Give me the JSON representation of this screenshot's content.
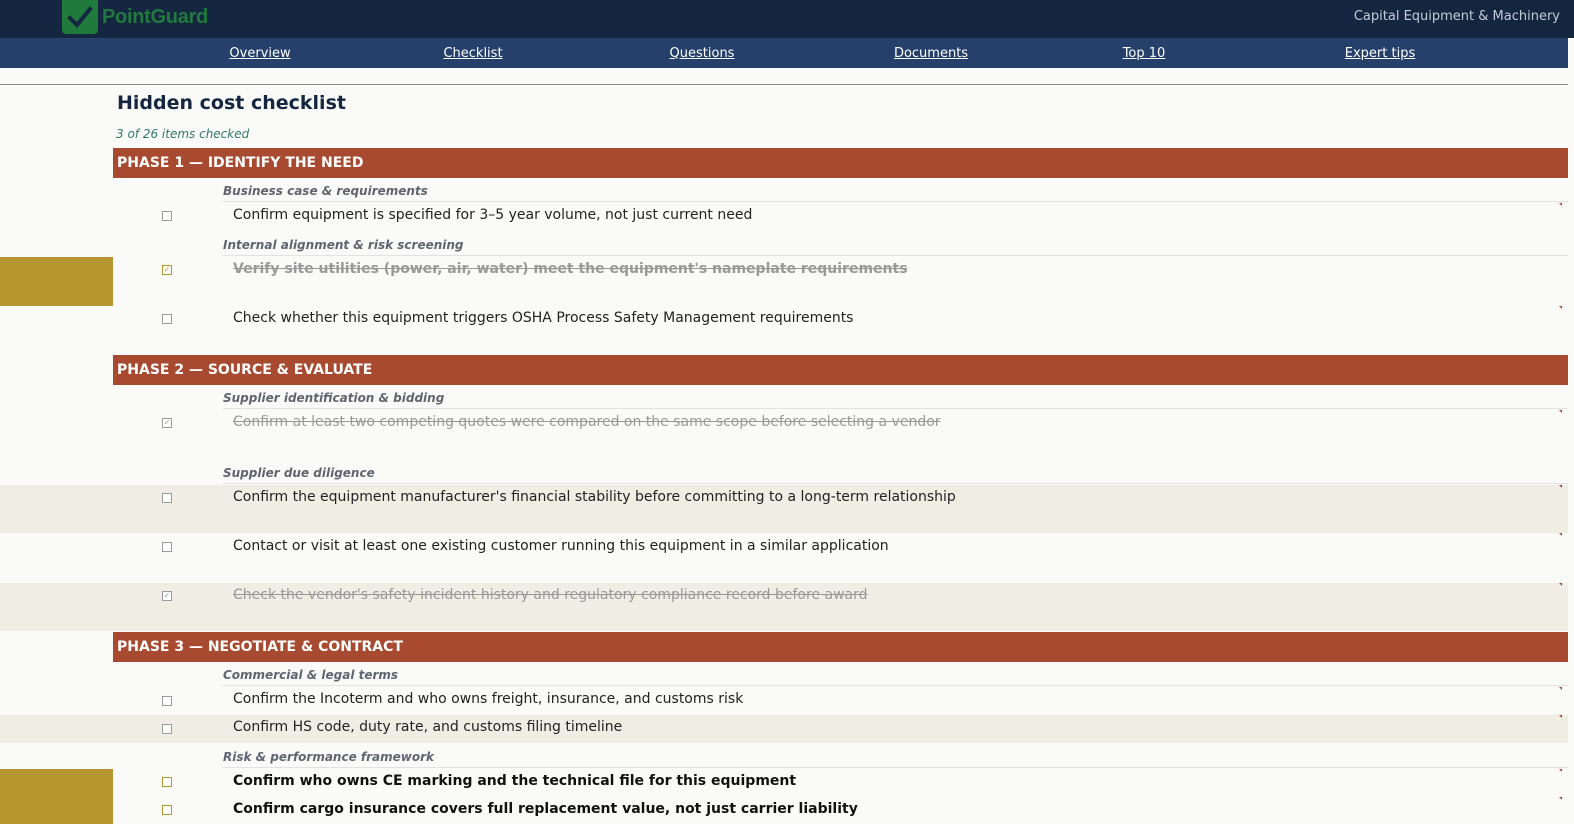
{
  "brand": {
    "name": "PointGuard",
    "sector": "Capital Equipment & Machinery"
  },
  "nav": [
    {
      "label": "Overview"
    },
    {
      "label": "Checklist"
    },
    {
      "label": "Questions"
    },
    {
      "label": "Documents"
    },
    {
      "label": "Top 10"
    },
    {
      "label": "Expert tips"
    }
  ],
  "page": {
    "title": "Hidden cost checklist",
    "progress": "3 of 26 items checked"
  },
  "phases": [
    {
      "title": "PHASE 1 — IDENTIFY THE NEED",
      "groups": [
        {
          "title": "Business case & requirements",
          "items": [
            {
              "text": "Confirm equipment is specified for 3–5 year volume, not just current need",
              "checked": false
            }
          ]
        },
        {
          "title": "Internal alignment & risk screening",
          "items": [
            {
              "text": "Verify site utilities (power, air, water) meet the equipment's nameplate requirements",
              "checked": true
            },
            {
              "text": "Check whether this equipment triggers OSHA Process Safety Management requirements",
              "checked": false
            }
          ]
        }
      ]
    },
    {
      "title": "PHASE 2 — SOURCE & EVALUATE",
      "groups": [
        {
          "title": "Supplier identification & bidding",
          "items": [
            {
              "text": "Confirm at least two competing quotes were compared on the same scope before selecting a vendor",
              "checked": true
            }
          ]
        },
        {
          "title": "Supplier due diligence",
          "items": [
            {
              "text": "Confirm the equipment manufacturer's financial stability before committing to a long-term relationship",
              "checked": false
            },
            {
              "text": "Contact or visit at least one existing customer running this equipment in a similar application",
              "checked": false
            },
            {
              "text": "Check the vendor's safety incident history and regulatory compliance record before award",
              "checked": true
            }
          ]
        }
      ]
    },
    {
      "title": "PHASE 3 — NEGOTIATE & CONTRACT",
      "groups": [
        {
          "title": "Commercial & legal terms",
          "items": [
            {
              "text": "Confirm the Incoterm and who owns freight, insurance, and customs risk",
              "checked": false
            },
            {
              "text": "Confirm HS code, duty rate, and customs filing timeline",
              "checked": false
            }
          ]
        },
        {
          "title": "Risk & performance framework",
          "items": [
            {
              "text": "Confirm who owns CE marking and the technical file for this equipment",
              "checked": false
            },
            {
              "text": "Confirm cargo insurance covers full replacement value, not just carrier liability",
              "checked": false
            }
          ]
        }
      ]
    }
  ],
  "colors": {
    "topbar": "#142640",
    "navbar": "#25406a",
    "phase": "#a84a30",
    "highlight": "#b8962f",
    "progress": "#2e7a6a"
  }
}
